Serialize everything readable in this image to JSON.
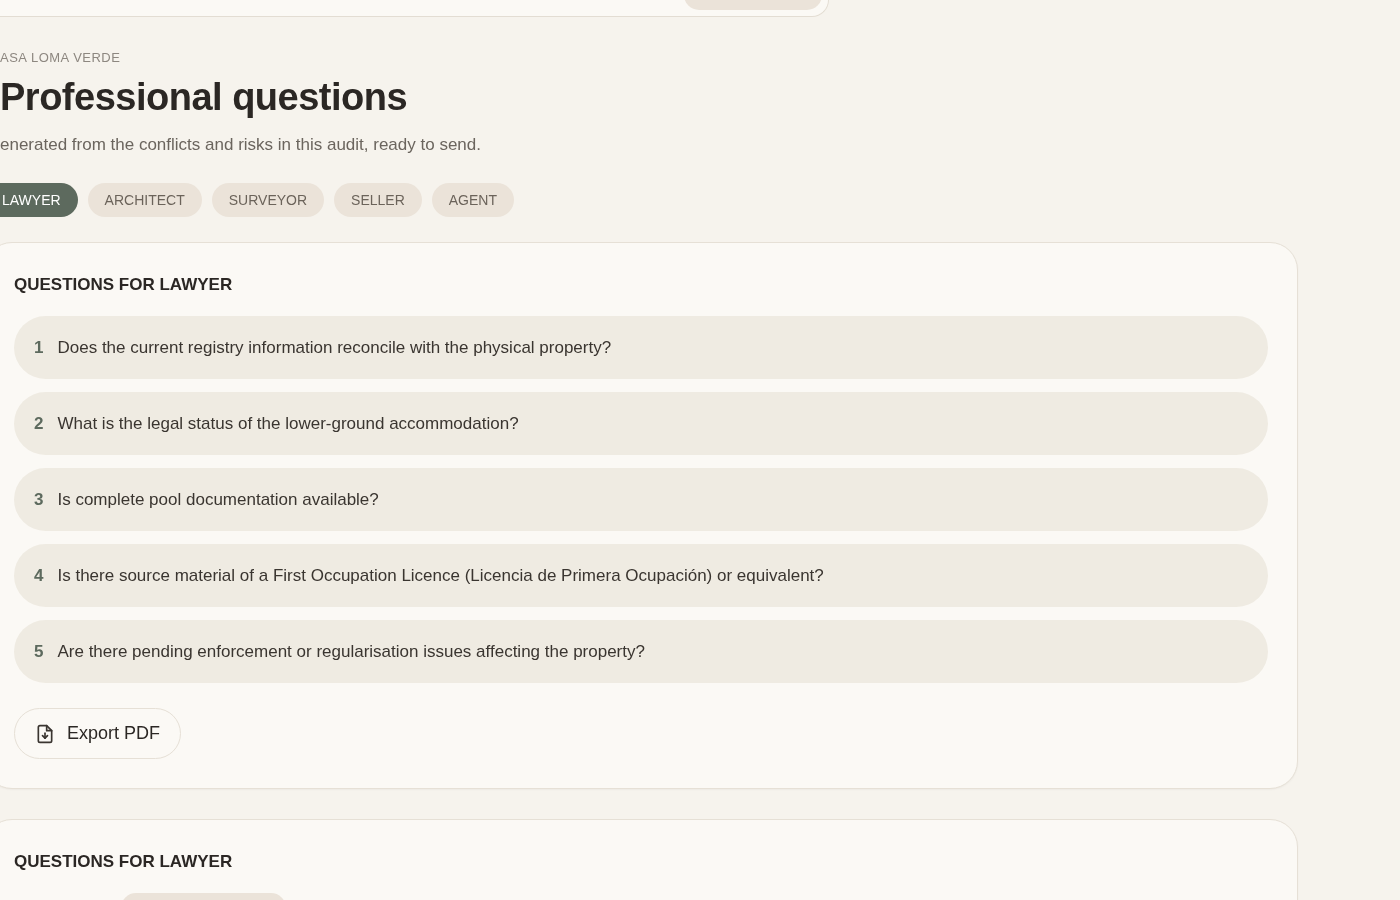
{
  "property": "ASA LOMA VERDE",
  "title": "Professional questions",
  "subtitle": "enerated from the conflicts and risks in this audit, ready to send.",
  "tabs": [
    {
      "label": "LAWYER",
      "selected": true
    },
    {
      "label": "ARCHITECT",
      "selected": false
    },
    {
      "label": "SURVEYOR",
      "selected": false
    },
    {
      "label": "SELLER",
      "selected": false
    },
    {
      "label": "AGENT",
      "selected": false
    }
  ],
  "cards": [
    {
      "heading": "QUESTIONS FOR LAWYER",
      "questions": [
        {
          "number": "1",
          "text": "Does the current registry information reconcile with the physical property?"
        },
        {
          "number": "2",
          "text": "What is the legal status of the lower-ground accommodation?"
        },
        {
          "number": "3",
          "text": "Is complete pool documentation available?"
        },
        {
          "number": "4",
          "text": "Is there source material of a First Occupation Licence (Licencia de Primera Ocupación) or equivalent?"
        },
        {
          "number": "5",
          "text": "Are there pending enforcement or regularisation issues affecting the property?"
        }
      ],
      "export_button": "Export PDF"
    },
    {
      "heading": "QUESTIONS FOR LAWYER"
    }
  ]
}
